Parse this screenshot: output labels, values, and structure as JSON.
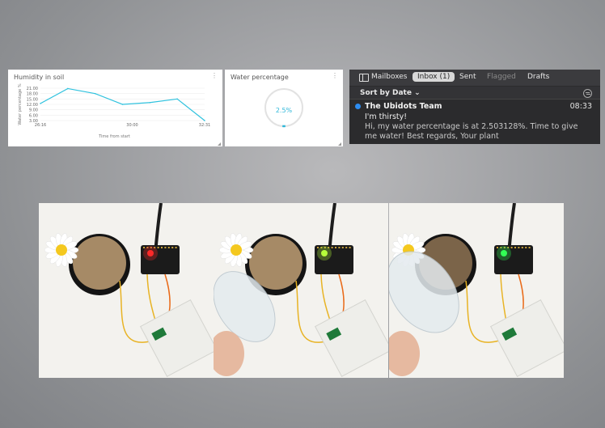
{
  "humidity_widget": {
    "title": "Humidity in soil",
    "chart_data": {
      "type": "line",
      "title": "Humidity in soil",
      "xlabel": "Time from start",
      "ylabel": "Water percentage %",
      "x_tick_labels": [
        "26:16",
        "30:00",
        "32:31"
      ],
      "y_ticks": [
        "21.00",
        "18.00",
        "15.00",
        "12.00",
        "9.00",
        "6.00",
        "3.00"
      ],
      "ylim": [
        3,
        21
      ],
      "grid": true,
      "series": [
        {
          "values": [
            12.5,
            20.8,
            18.0,
            12.0,
            13.0,
            15.0,
            3.0
          ]
        }
      ],
      "color": "#2fc2de"
    }
  },
  "water_widget": {
    "title": "Water percentage",
    "value_text": "2.5%",
    "value": 2.5,
    "color": "#2fb7d9"
  },
  "mail": {
    "tabs": {
      "mailboxes": "Mailboxes",
      "inbox": "Inbox (1)",
      "sent": "Sent",
      "flagged": "Flagged",
      "drafts": "Drafts"
    },
    "sort_label": "Sort by Date ⌄",
    "message": {
      "sender": "The Ubidots Team",
      "time": "08:33",
      "subject": "I'm thirsty!",
      "preview": "Hi, my water percentage is at 2.503128%. Time to give me water! Best regards, Your plant"
    }
  },
  "photos": [
    {
      "led_color": "#ff2a2a",
      "pouring": false
    },
    {
      "led_color": "#b6ff3a",
      "pouring": true
    },
    {
      "led_color": "#33ff55",
      "pouring": true
    }
  ]
}
